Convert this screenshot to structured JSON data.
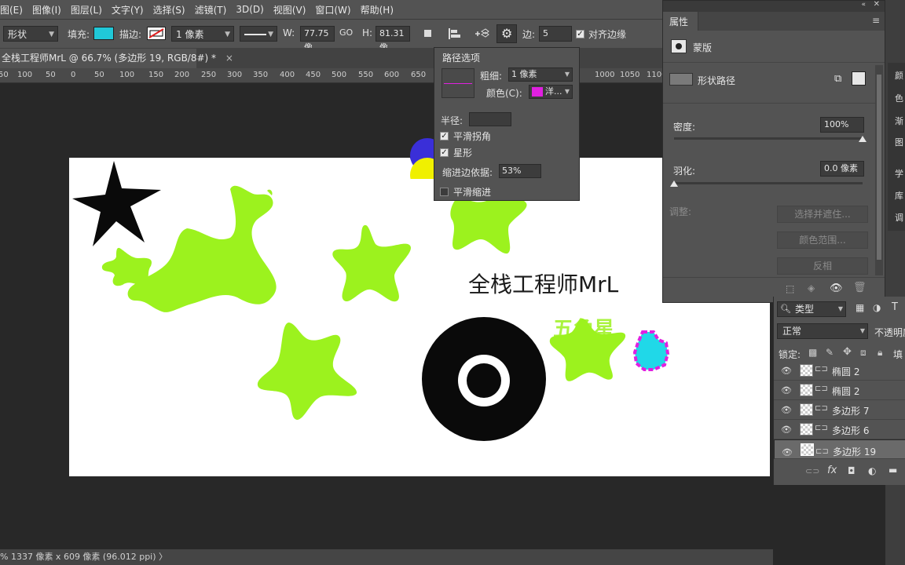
{
  "menu": [
    "图(E)",
    "图像(I)",
    "图层(L)",
    "文字(Y)",
    "选择(S)",
    "滤镜(T)",
    "3D(D)",
    "视图(V)",
    "窗口(W)",
    "帮助(H)"
  ],
  "options": {
    "mode_value": "形状",
    "fill_label": "填充:",
    "fill_color": "#20c8d8",
    "stroke_label": "描边:",
    "stroke_size_value": "1 像素",
    "w_label": "W:",
    "w_value": "77.75 像",
    "link_label": "GO",
    "h_label": "H:",
    "h_value": "81.31 像",
    "sides_label": "边:",
    "sides_value": "5",
    "align_edges_label": "对齐边缘"
  },
  "doc_tab": {
    "title": "全栈工程师MrL @ 66.7% (多边形 19, RGB/8#) *",
    "close": "×"
  },
  "ruler_ticks": [
    "50",
    "100",
    "50",
    "0",
    "50",
    "100",
    "150",
    "200",
    "250",
    "300",
    "350",
    "400",
    "450",
    "500",
    "550",
    "600",
    "650",
    "1000",
    "1050",
    "1100"
  ],
  "path_options": {
    "title": "路径选项",
    "thickness_label": "粗细:",
    "thickness_value": "1 像素",
    "color_label": "颜色(C):",
    "color_value": "洋...",
    "color_swatch": "#e020e0",
    "radius_label": "半径:",
    "radius_value": "",
    "smooth_corners_label": "平滑拐角",
    "star_label": "星形",
    "indent_label": "缩进边依据:",
    "indent_value": "53%",
    "smooth_indent_label": "平滑缩进"
  },
  "properties": {
    "title": "属性",
    "mask_label": "蒙版",
    "shape_path_label": "形状路径",
    "density_label": "密度:",
    "density_value": "100%",
    "density_level": 100,
    "feather_label": "羽化:",
    "feather_value": "0.0 像素",
    "feather_level": 0,
    "adjust_label": "调整:",
    "select_mask_button": "选择并遮住...",
    "color_range_button": "颜色范围...",
    "invert_button": "反相"
  },
  "right_dock_labels": [
    "颜",
    "色",
    "渐",
    "图",
    "学",
    "库",
    "调"
  ],
  "layers": {
    "filter_value": "类型",
    "blend_value": "正常",
    "opacity_label": "不透明度",
    "lock_label": "锁定:",
    "fill_label": "填",
    "items": [
      {
        "name": "椭圆 2",
        "selected": false
      },
      {
        "name": "椭圆 2",
        "selected": false
      },
      {
        "name": "多边形 7",
        "selected": false
      },
      {
        "name": "多边形 6",
        "selected": false
      },
      {
        "name": "多边形 19",
        "selected": true
      }
    ]
  },
  "canvas": {
    "heading": "全栈工程师MrL",
    "subheading": "五角星",
    "star_green": "#9cf21e",
    "black": "#0a0a0a",
    "cyan": "#20d8e8",
    "magenta": "#e020e0"
  },
  "status_text": "% 1337 像素 x 609 像素 (96.012 ppi) 〉"
}
